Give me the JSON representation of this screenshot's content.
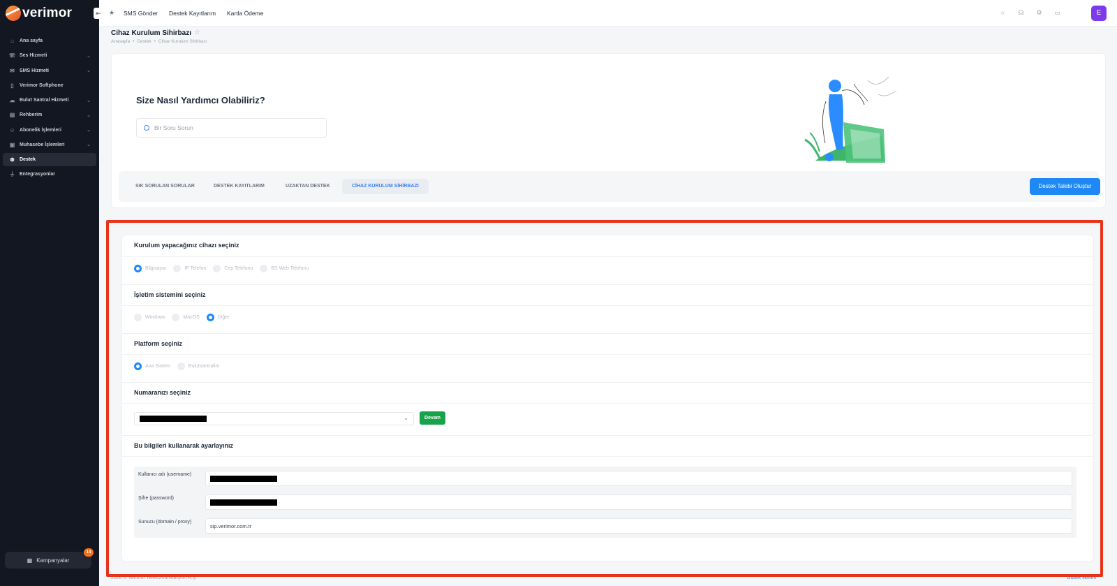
{
  "brand": {
    "name": "verimor",
    "accent": "#1e88f4"
  },
  "sidebar": {
    "items": [
      {
        "label": "Ana sayfa",
        "icon": "home-icon",
        "has_children": false,
        "active": false
      },
      {
        "label": "Ses Hizmeti",
        "icon": "phone-icon",
        "has_children": true,
        "active": false
      },
      {
        "label": "SMS Hizmeti",
        "icon": "message-icon",
        "has_children": true,
        "active": false
      },
      {
        "label": "Verimor Softphone",
        "icon": "mobile-icon",
        "has_children": false,
        "active": false
      },
      {
        "label": "Bulut Santral Hizmeti",
        "icon": "cloud-icon",
        "has_children": true,
        "active": false
      },
      {
        "label": "Rehberim",
        "icon": "contacts-icon",
        "has_children": true,
        "active": false
      },
      {
        "label": "Abonelik İşlemleri",
        "icon": "user-icon",
        "has_children": true,
        "active": false
      },
      {
        "label": "Muhasebe İşlemleri",
        "icon": "wallet-icon",
        "has_children": true,
        "active": false
      },
      {
        "label": "Destek",
        "icon": "lifebuoy-icon",
        "has_children": false,
        "active": true
      },
      {
        "label": "Entegrasyonlar",
        "icon": "plug-icon",
        "has_children": false,
        "active": false
      }
    ],
    "campaign": {
      "label": "Kampanyalar",
      "badge": "14"
    }
  },
  "topbar": {
    "links": [
      "SMS Gönder",
      "Destek Kayıtlarım",
      "Kartla Ödeme"
    ],
    "avatar_letter": "E"
  },
  "page": {
    "title": "Cihaz Kurulum Sihirbazı",
    "breadcrumb": [
      "Anasayfa",
      "Destek",
      "Cihaz Kurulum Sihirbazı"
    ]
  },
  "hero": {
    "heading": "Size Nasıl Yardımcı Olabiliriz?",
    "search_placeholder": "Bir Soru Sorun",
    "tabs": [
      "SIK SORULAN SORULAR",
      "DESTEK KAYITLARIM",
      "UZAKTAN DESTEK",
      "CİHAZ KURULUM SİHİRBAZI"
    ],
    "active_tab": "CİHAZ KURULUM SİHİRBAZI",
    "ticket_button": "Destek Talebi Oluştur"
  },
  "wizard": {
    "device": {
      "title": "Kurulum yapacağınız cihazı seçiniz",
      "options": [
        "Bilgisayar",
        "IP Telefon",
        "Cep Telefonu",
        "BS Web Telefonu"
      ],
      "selected": "Bilgisayar"
    },
    "os": {
      "title": "İşletim sistemini seçiniz",
      "options": [
        "Windows",
        "MacOS",
        "Diğer"
      ],
      "selected": "Diğer"
    },
    "platform": {
      "title": "Platform seçiniz",
      "options": [
        "Ana Sistem",
        "Bulutsantralim"
      ],
      "selected": "Ana Sistem"
    },
    "number": {
      "title": "Numaranızı seçiniz",
      "continue_button": "Devam"
    },
    "credentials": {
      "title": "Bu bilgileri kullanarak ayarlayınız",
      "rows": [
        {
          "label": "Kullanıcı adı (username)",
          "value": ""
        },
        {
          "label": "Şifre (password)",
          "value": ""
        },
        {
          "label": "Sunucu (domain / proxy)",
          "value": "sip.verimor.com.tr"
        }
      ]
    }
  },
  "footer": {
    "copyright": "2026 © Verimor Telekomünikasyon A.Ş.",
    "privacy": "Gizlilik İlkeleri"
  }
}
